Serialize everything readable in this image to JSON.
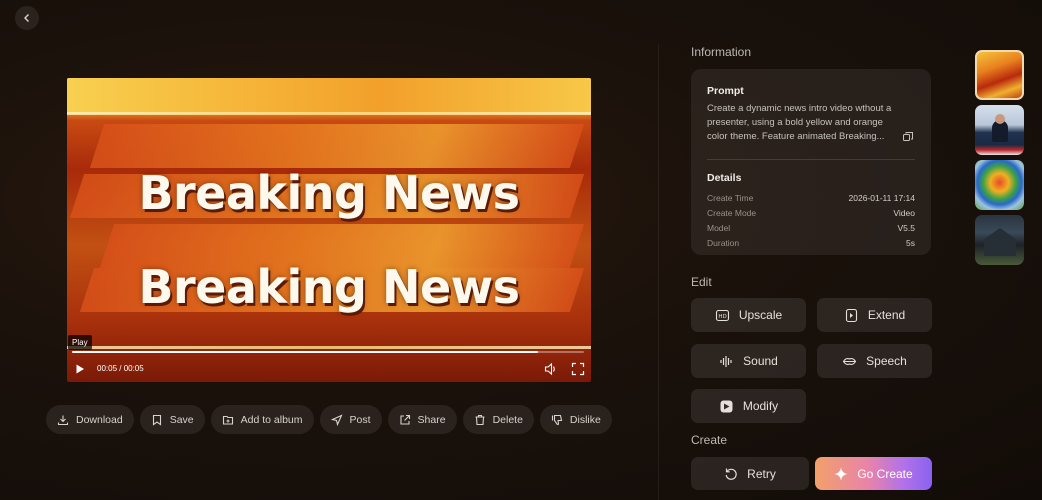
{
  "nav": {
    "back_icon": "chevron-left-icon"
  },
  "video": {
    "headline_top": "Breaking News",
    "headline_bottom": "Breaking News",
    "play_tooltip": "Play",
    "time": "00:05 / 00:05",
    "progress": 0.91
  },
  "actions": [
    {
      "label": "Download",
      "icon": "download-icon"
    },
    {
      "label": "Save",
      "icon": "bookmark-icon"
    },
    {
      "label": "Add to album",
      "icon": "album-add-icon"
    },
    {
      "label": "Post",
      "icon": "send-icon"
    },
    {
      "label": "Share",
      "icon": "share-icon"
    },
    {
      "label": "Delete",
      "icon": "trash-icon"
    },
    {
      "label": "Dislike",
      "icon": "thumbs-down-icon"
    }
  ],
  "information": {
    "title": "Information",
    "prompt_label": "Prompt",
    "prompt_text": "Create a dynamic news intro video wthout a presenter, using a bold yellow and orange color theme. Feature animated Breaking...",
    "details_label": "Details",
    "details": [
      {
        "key": "Create Time",
        "value": "2026-01-11 17:14"
      },
      {
        "key": "Create Mode",
        "value": "Video"
      },
      {
        "key": "Model",
        "value": "V5.5"
      },
      {
        "key": "Duration",
        "value": "5s"
      }
    ]
  },
  "edit": {
    "title": "Edit",
    "upscale": "Upscale",
    "extend": "Extend",
    "sound": "Sound",
    "speech": "Speech",
    "modify": "Modify"
  },
  "create": {
    "title": "Create",
    "retry": "Retry",
    "go_create": "Go Create"
  },
  "colors": {
    "accent_gradient_start": "#f2a06a",
    "accent_gradient_end": "#8a62f0",
    "active_thumb_border": "#f3d9b0"
  }
}
